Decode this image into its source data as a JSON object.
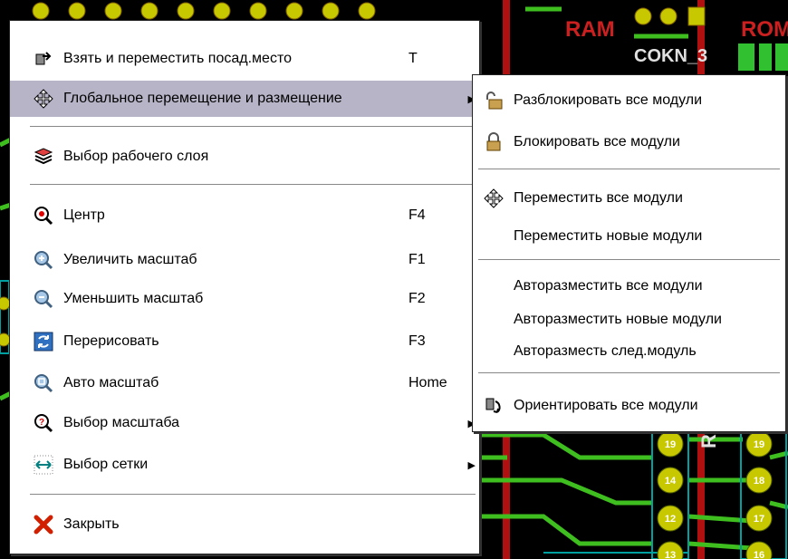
{
  "background": {
    "labels": [
      "RAM",
      "COKN_3",
      "ROM"
    ],
    "pads": [
      "19",
      "19",
      "14",
      "18",
      "12",
      "17",
      "13",
      "16"
    ]
  },
  "main_menu": {
    "items": [
      {
        "label": "Взять и переместить посад.место",
        "shortcut": "T",
        "icon": "move-footprint-icon"
      },
      {
        "label": "Глобальное перемещение и размещение",
        "shortcut": "",
        "icon": "move-cross-icon",
        "submenu": true,
        "highlighted": true
      },
      {
        "label": "Выбор рабочего слоя",
        "shortcut": "",
        "icon": "layers-icon"
      },
      {
        "label": "Центр",
        "shortcut": "F4",
        "icon": "zoom-center-icon"
      },
      {
        "label": "Увеличить масштаб",
        "shortcut": "F1",
        "icon": "zoom-in-icon"
      },
      {
        "label": "Уменьшить масштаб",
        "shortcut": "F2",
        "icon": "zoom-out-icon"
      },
      {
        "label": "Перерисовать",
        "shortcut": "F3",
        "icon": "redraw-icon"
      },
      {
        "label": "Авто масштаб",
        "shortcut": "Home",
        "icon": "zoom-auto-icon"
      },
      {
        "label": "Выбор масштаба",
        "shortcut": "",
        "icon": "zoom-select-icon",
        "submenu": true
      },
      {
        "label": "Выбор сетки",
        "shortcut": "",
        "icon": "grid-select-icon",
        "submenu": true
      },
      {
        "label": "Закрыть",
        "shortcut": "",
        "icon": "close-icon"
      }
    ]
  },
  "sub_menu": {
    "items": [
      {
        "label": "Разблокировать все модули",
        "icon": "unlock-icon"
      },
      {
        "label": "Блокировать все модули",
        "icon": "lock-icon"
      },
      {
        "label": "Переместить все модули",
        "icon": "move-cross-icon"
      },
      {
        "label": "Переместить новые модули",
        "icon": ""
      },
      {
        "label": "Авторазместить все модули",
        "icon": ""
      },
      {
        "label": "Авторазместить новые модули",
        "icon": ""
      },
      {
        "label": "Авторазместь след.модуль",
        "icon": ""
      },
      {
        "label": "Ориентировать все модули",
        "icon": "orient-icon"
      }
    ]
  },
  "colors": {
    "highlight": "#b8b4c8",
    "trace": "#3fbf1f",
    "pad": "#c8c800",
    "silkscreen": "#00a0a0",
    "label_red": "#cc2020"
  }
}
